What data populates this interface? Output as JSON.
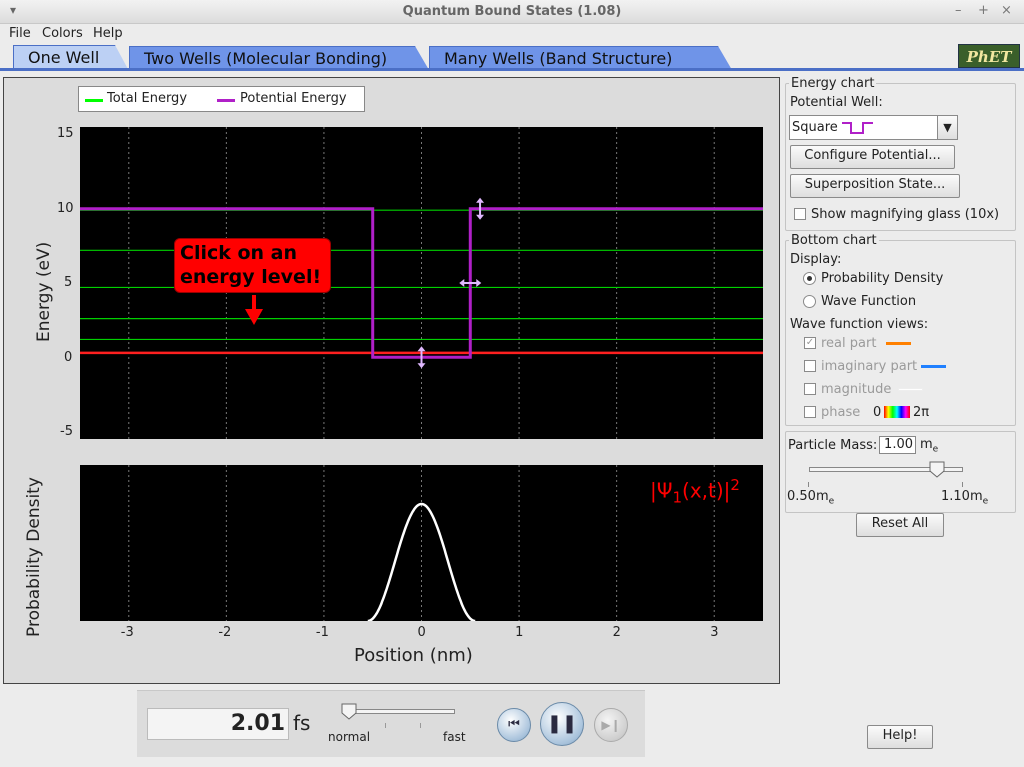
{
  "window": {
    "title": "Quantum Bound States (1.08)"
  },
  "menu": {
    "file": "File",
    "colors": "Colors",
    "help": "Help"
  },
  "tabs": [
    {
      "label": "One Well"
    },
    {
      "label": "Two Wells (Molecular Bonding)"
    },
    {
      "label": "Many Wells (Band Structure)"
    }
  ],
  "logo": {
    "text": "PhET"
  },
  "legend": {
    "total": "Total Energy",
    "total_color": "#00ff00",
    "potential": "Potential Energy",
    "potential_color": "#b020c8"
  },
  "callout": {
    "text": "Click on an energy level!"
  },
  "psi_label": {
    "main": "|Ψ",
    "sub": "1",
    "rest": "(x,t)|",
    "sup": "2"
  },
  "chart_data": [
    {
      "type": "line",
      "ylabel": "Energy (eV)",
      "ylim": [
        -5.5,
        15.5
      ],
      "xlim": [
        -3.5,
        3.5
      ],
      "yticks": [
        "15",
        "10",
        "5",
        "0",
        "-5"
      ],
      "ytick_values": [
        15,
        10,
        5,
        0,
        -5
      ],
      "xgrid": [
        -3,
        -2,
        -1,
        0,
        1,
        2,
        3
      ],
      "potential": {
        "x": [
          -3.5,
          -0.5,
          -0.5,
          0.5,
          0.5,
          3.5
        ],
        "y": [
          10,
          10,
          0,
          0,
          10,
          10
        ],
        "color": "#b020c8"
      },
      "energy_levels": [
        0.3,
        1.2,
        2.6,
        4.7,
        7.2,
        9.9
      ],
      "level_color": "#00d000",
      "selected_level": 0.3,
      "selected_color": "#ff2020"
    },
    {
      "type": "line",
      "ylabel": "Probability Density",
      "xlabel": "Position (nm)",
      "xlim": [
        -3.5,
        3.5
      ],
      "xticks": [
        "-3",
        "-2",
        "-1",
        "0",
        "1",
        "2",
        "3"
      ],
      "xtick_values": [
        -3,
        -2,
        -1,
        0,
        1,
        2,
        3
      ],
      "curve": {
        "center": 0,
        "half_width": 0.55,
        "peak": 0.75
      },
      "curve_color": "#ffffff"
    }
  ],
  "controls": {
    "energy_chart_title": "Energy chart",
    "potential_well_label": "Potential Well:",
    "potential_well_value": "Square",
    "configure_button": "Configure Potential...",
    "superposition_button": "Superposition State...",
    "magnify_label": "Show magnifying glass (10x)",
    "bottom_chart_title": "Bottom chart",
    "display_label": "Display:",
    "prob_density_label": "Probability Density",
    "wave_function_label": "Wave Function",
    "wf_views_label": "Wave function views:",
    "real_part": "real part",
    "real_color": "#ff8000",
    "imag_part": "imaginary part",
    "imag_color": "#2080ff",
    "magnitude": "magnitude",
    "magnitude_color": "#ffffff",
    "phase": "phase",
    "phase_start": "0",
    "phase_end": "2π",
    "particle_mass_label": "Particle Mass:",
    "particle_mass_value": "1.00",
    "mass_unit": "m",
    "mass_unit_sub": "e",
    "mass_min": "0.50m",
    "mass_max": "1.10m",
    "mass_fraction": 0.83,
    "reset_button": "Reset All",
    "help_button": "Help!"
  },
  "clock": {
    "time_value": "2.01",
    "time_unit": "fs",
    "speed_slow": "normal",
    "speed_fast": "fast",
    "speed_fraction": 0.0
  }
}
